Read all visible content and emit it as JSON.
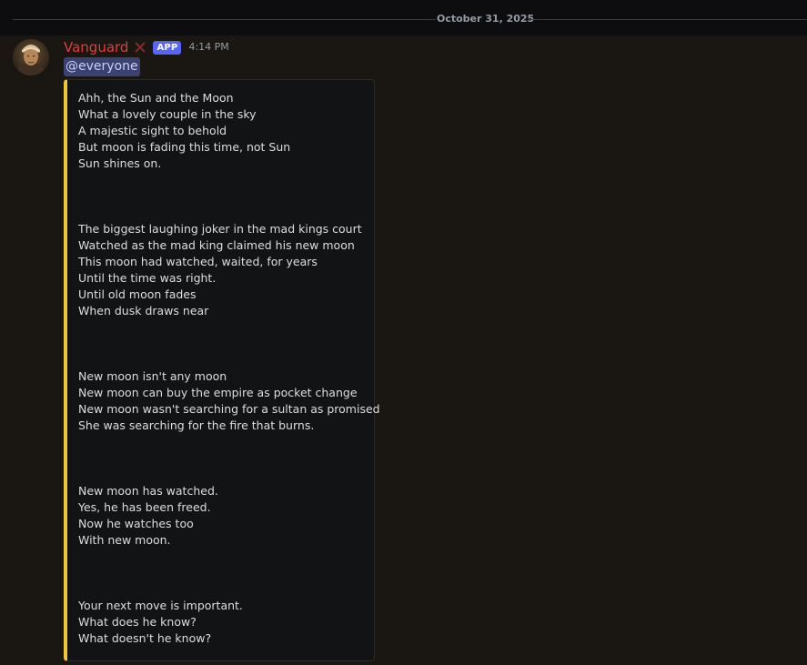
{
  "date_divider": "October 31, 2025",
  "message": {
    "author": "Vanguard",
    "badge": "APP",
    "timestamp": "4:14 PM",
    "mention": "@everyone",
    "embed": {
      "accent_color": "#f0c632",
      "description": "Ahh, the Sun and the Moon\nWhat a lovely couple in the sky\nA majestic sight to behold\nBut moon is fading this time, not Sun\nSun shines on.\n\n\n\nThe biggest laughing joker in the mad kings court\nWatched as the mad king claimed his new moon\nThis moon had watched, waited, for years\nUntil the time was right.\nUntil old moon fades\nWhen dusk draws near\n\n\n\nNew moon isn't any moon\nNew moon can buy the empire as pocket change\nNew moon wasn't searching for a sultan as promised\nShe was searching for the fire that burns.\n\n\n\nNew moon has watched.\nYes, he has been freed.\nNow he watches too\nWith new moon.\n\n\n\nYour next move is important.\nWhat does he know?\nWhat doesn't he know?"
    }
  },
  "colors": {
    "author_name": "#e23c3c",
    "app_badge": "#5865f2",
    "mention_bg": "#3c4270",
    "background": "#1a1712"
  },
  "icons": {
    "avatar": "avatar-portrait",
    "author_decoration": "x-icon"
  }
}
